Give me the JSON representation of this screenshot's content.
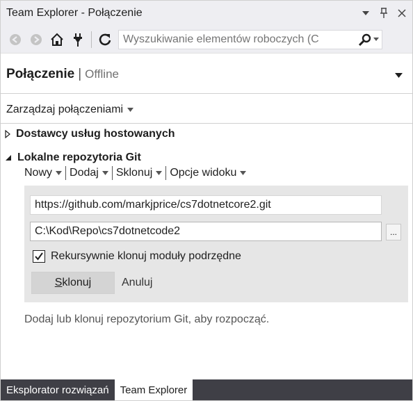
{
  "window": {
    "title": "Team Explorer - Połączenie",
    "dropdown_glyph": "▾",
    "pin_glyph": "🖈",
    "close_glyph": "✕"
  },
  "toolbar": {
    "icons": [
      "back-icon",
      "forward-icon",
      "home-icon",
      "plug-icon",
      "refresh-icon"
    ],
    "search_placeholder": "Wyszukiwanie elementów roboczych (C"
  },
  "header": {
    "title": "Połączenie",
    "separator": "|",
    "subtitle": "Offline"
  },
  "manage_connections": "Zarządzaj połączeniami",
  "sections": {
    "hosted": "Dostawcy usług hostowanych",
    "local": "Lokalne repozytoria Git"
  },
  "actions": {
    "new": "Nowy",
    "add": "Dodaj",
    "clone": "Sklonuj",
    "view_options": "Opcje widoku"
  },
  "clone_panel": {
    "url_value": "https://github.com/markjprice/cs7dotnetcore2.git",
    "path_value": "C:\\Kod\\Repo\\cs7dotnetcode2",
    "browse_label": "...",
    "recursive_label": "Rekursywnie klonuj moduły podrzędne",
    "recursive_checked": true,
    "clone_button_mnemonic": "S",
    "clone_button_rest": "klonuj",
    "cancel_label": "Anuluj"
  },
  "hint": "Dodaj lub klonuj repozytorium Git, aby rozpocząć.",
  "tabs": [
    {
      "label": "Eksplorator rozwiązań",
      "active": false
    },
    {
      "label": "Team Explorer",
      "active": true
    }
  ],
  "colors": {
    "chrome": "#eeeef2",
    "panel": "#e6e6e6",
    "tabbar": "#3f3f46"
  }
}
